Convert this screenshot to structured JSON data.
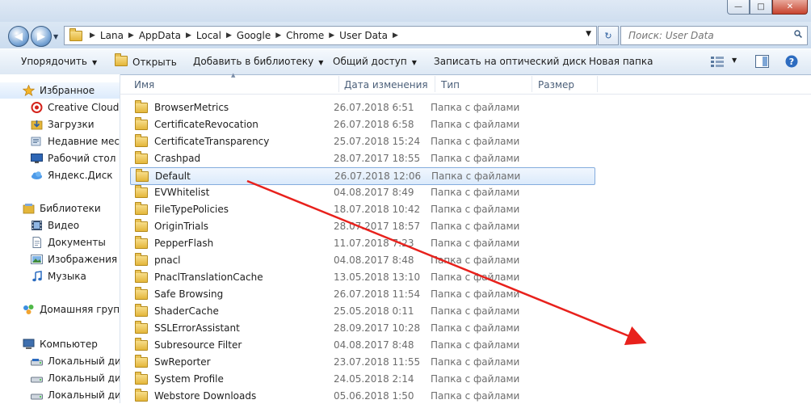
{
  "window": {
    "minimize": "—",
    "maximize": "□",
    "close": "✕"
  },
  "address": {
    "crumbs": [
      "Lana",
      "AppData",
      "Local",
      "Google",
      "Chrome",
      "User Data"
    ]
  },
  "search": {
    "placeholder": "Поиск: User Data"
  },
  "toolbar": {
    "organize": "Упорядочить",
    "open": "Открыть",
    "add_to_library": "Добавить в библиотеку",
    "share": "Общий доступ",
    "burn": "Записать на оптический диск",
    "new_folder": "Новая папка"
  },
  "nav": {
    "favorites": "Избранное",
    "creative_cloud": "Creative Cloud F",
    "downloads": "Загрузки",
    "recent": "Недавние места",
    "desktop": "Рабочий стол",
    "yadisk": "Яндекс.Диск",
    "libraries": "Библиотеки",
    "video": "Видео",
    "documents": "Документы",
    "images": "Изображения",
    "music": "Музыка",
    "homegroup": "Домашняя группа",
    "computer": "Компьютер",
    "disk1": "Локальный дис",
    "disk2": "Локальный дис",
    "disk3": "Локальный дис"
  },
  "columns": {
    "name": "Имя",
    "date": "Дата изменения",
    "type": "Тип",
    "size": "Размер"
  },
  "files": [
    {
      "name": "BrowserMetrics",
      "date": "26.07.2018 6:51",
      "type": "Папка с файлами"
    },
    {
      "name": "CertificateRevocation",
      "date": "26.07.2018 6:58",
      "type": "Папка с файлами"
    },
    {
      "name": "CertificateTransparency",
      "date": "25.07.2018 15:24",
      "type": "Папка с файлами"
    },
    {
      "name": "Crashpad",
      "date": "28.07.2017 18:55",
      "type": "Папка с файлами"
    },
    {
      "name": "Default",
      "date": "26.07.2018 12:06",
      "type": "Папка с файлами"
    },
    {
      "name": "EVWhitelist",
      "date": "04.08.2017 8:49",
      "type": "Папка с файлами"
    },
    {
      "name": "FileTypePolicies",
      "date": "18.07.2018 10:42",
      "type": "Папка с файлами"
    },
    {
      "name": "OriginTrials",
      "date": "28.07.2017 18:57",
      "type": "Папка с файлами"
    },
    {
      "name": "PepperFlash",
      "date": "11.07.2018 7:23",
      "type": "Папка с файлами"
    },
    {
      "name": "pnacl",
      "date": "04.08.2017 8:48",
      "type": "Папка с файлами"
    },
    {
      "name": "PnaclTranslationCache",
      "date": "13.05.2018 13:10",
      "type": "Папка с файлами"
    },
    {
      "name": "Safe Browsing",
      "date": "26.07.2018 11:54",
      "type": "Папка с файлами"
    },
    {
      "name": "ShaderCache",
      "date": "25.05.2018 0:11",
      "type": "Папка с файлами"
    },
    {
      "name": "SSLErrorAssistant",
      "date": "28.09.2017 10:28",
      "type": "Папка с файлами"
    },
    {
      "name": "Subresource Filter",
      "date": "04.08.2017 8:48",
      "type": "Папка с файлами"
    },
    {
      "name": "SwReporter",
      "date": "23.07.2018 11:55",
      "type": "Папка с файлами"
    },
    {
      "name": "System Profile",
      "date": "24.05.2018 2:14",
      "type": "Папка с файлами"
    },
    {
      "name": "Webstore Downloads",
      "date": "05.06.2018 1:50",
      "type": "Папка с файлами"
    }
  ],
  "selected_index": 4,
  "colors": {
    "annotation_arrow": "#e8211c"
  }
}
